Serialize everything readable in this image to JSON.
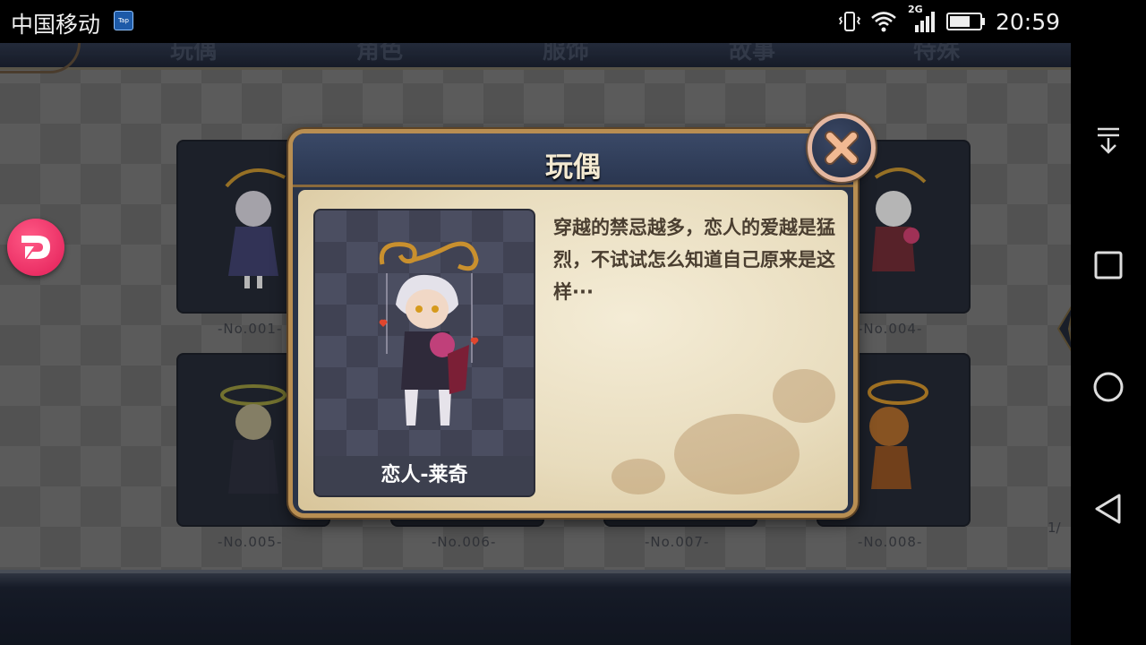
{
  "statusbar": {
    "carrier": "中国移动",
    "app_badge": "Tap",
    "network": "2G",
    "time": "20:59"
  },
  "top_tabs": [
    "玩偶",
    "角色",
    "服饰",
    "故事",
    "特殊"
  ],
  "cards": [
    {
      "num": "-No.001-"
    },
    {
      "num": "-No.004-"
    },
    {
      "num": "-No.005-"
    },
    {
      "num": "-No.006-"
    },
    {
      "num": "-No.007-"
    },
    {
      "num": "-No.008-"
    }
  ],
  "page_indicator": "1/",
  "modal": {
    "title": "玩偶",
    "doll_name": "恋人-莱奇",
    "description": "穿越的禁忌越多，恋人的爱越是猛烈，不试试怎么知道自己原来是这样···"
  },
  "colors": {
    "accent_pink": "#e21d57",
    "modal_frame": "#b88e52",
    "parchment": "#e8dcbd"
  },
  "icons": {
    "nav": [
      "download-icon",
      "recent-apps-icon",
      "home-icon",
      "back-icon"
    ]
  }
}
